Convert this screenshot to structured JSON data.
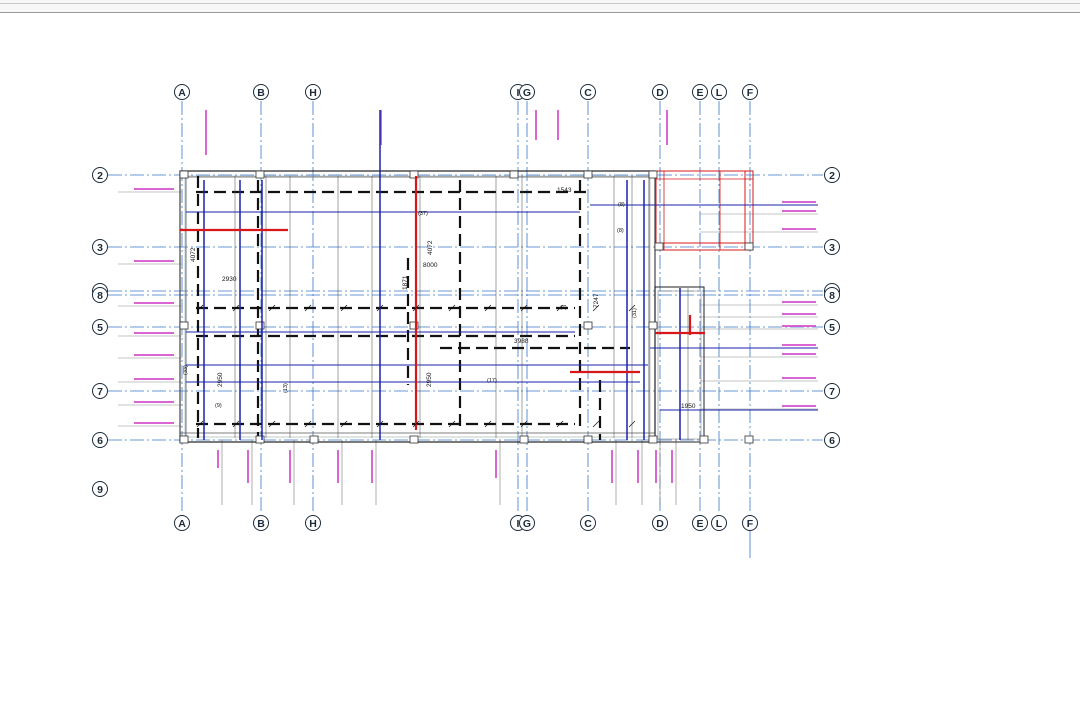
{
  "viewer": {
    "title": "",
    "colors": {
      "grid_line": "#3a78c8",
      "grid_bubble": "#1a2a3a",
      "wall": "#222222",
      "beam_blue": "#1a22aa",
      "beam_red": "#d81818",
      "annotation_magenta": "#d040c8",
      "dimension": "#111111"
    }
  },
  "drawing": {
    "columns_top": [
      "A",
      "B",
      "H",
      "I",
      "G",
      "C",
      "D",
      "E",
      "L",
      "F"
    ],
    "columns_bottom": [
      "A",
      "B",
      "H",
      "I",
      "G",
      "C",
      "D",
      "E",
      "L",
      "F"
    ],
    "rows_left": [
      "2",
      "3",
      "4",
      "8",
      "5",
      "7",
      "6",
      "9"
    ],
    "rows_right": [
      "2",
      "3",
      "4",
      "8",
      "5",
      "7",
      "6"
    ],
    "dimensions": [
      "4072",
      "2930",
      "4072",
      "8000",
      "1871",
      "1543",
      "3988",
      "2950",
      "2950",
      "7247",
      "1950"
    ],
    "bar_marks": [
      "(37)",
      "(17)",
      "(33)",
      "(31)",
      "(8)",
      "(7)",
      "(9)",
      "(8)",
      "(13)"
    ]
  }
}
